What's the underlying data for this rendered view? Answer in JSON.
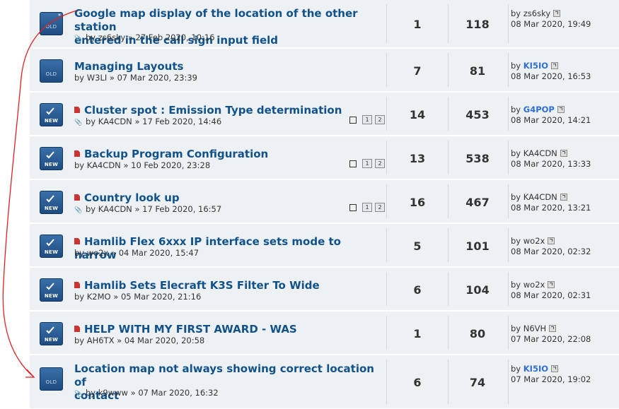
{
  "topics": [
    {
      "status": "old",
      "icon_label": "OLD",
      "star": true,
      "has_doc_icon": false,
      "title_lines": [
        "Google map display of the location of the other station",
        "entered in the call sign input field"
      ],
      "meta_prefix": "by",
      "author": "zs6sky",
      "date": "» 27 Feb 2020, 10:16",
      "attachment": true,
      "pages": [],
      "replies": "1",
      "views": "118",
      "last_by": "by",
      "last_user": "zs6sky",
      "last_user_mod": false,
      "last_date": "08 Mar 2020, 19:49"
    },
    {
      "status": "old",
      "icon_label": "OLD",
      "star": false,
      "has_doc_icon": false,
      "title_lines": [
        "Managing Layouts"
      ],
      "meta_prefix": "by",
      "author": "W3LI",
      "date": "» 07 Mar 2020, 23:39",
      "attachment": false,
      "pages": [],
      "replies": "7",
      "views": "81",
      "last_by": "by",
      "last_user": "KI5IO",
      "last_user_mod": true,
      "last_date": "08 Mar 2020, 16:53"
    },
    {
      "status": "new",
      "icon_label": "NEW",
      "star": false,
      "has_doc_icon": true,
      "title_lines": [
        "Cluster spot : Emission Type determination"
      ],
      "meta_prefix": "by",
      "author": "KA4CDN",
      "date": "» 17 Feb 2020, 14:46",
      "attachment": true,
      "pages": [
        "1",
        "2"
      ],
      "replies": "14",
      "views": "453",
      "last_by": "by",
      "last_user": "G4POP",
      "last_user_mod": true,
      "last_date": "08 Mar 2020, 14:21"
    },
    {
      "status": "new",
      "icon_label": "NEW",
      "star": false,
      "has_doc_icon": true,
      "title_lines": [
        "Backup Program Configuration"
      ],
      "meta_prefix": "by",
      "author": "KA4CDN",
      "date": "» 10 Feb 2020, 23:28",
      "attachment": false,
      "pages": [
        "1",
        "2"
      ],
      "replies": "13",
      "views": "538",
      "last_by": "by",
      "last_user": "KA4CDN",
      "last_user_mod": false,
      "last_date": "08 Mar 2020, 13:33"
    },
    {
      "status": "new",
      "icon_label": "NEW",
      "star": false,
      "has_doc_icon": true,
      "title_lines": [
        "Country look up"
      ],
      "meta_prefix": "by",
      "author": "KA4CDN",
      "date": "» 17 Feb 2020, 16:57",
      "attachment": true,
      "pages": [
        "1",
        "2"
      ],
      "replies": "16",
      "views": "467",
      "last_by": "by",
      "last_user": "KA4CDN",
      "last_user_mod": false,
      "last_date": "08 Mar 2020, 13:21"
    },
    {
      "status": "new",
      "icon_label": "NEW",
      "star": false,
      "has_doc_icon": true,
      "title_lines": [
        "Hamlib Flex 6xxx IP interface sets mode to narrow"
      ],
      "meta_prefix": "by",
      "author": "wo2x",
      "date": "» 04 Mar 2020, 15:47",
      "attachment": false,
      "pages": [],
      "replies": "5",
      "views": "101",
      "last_by": "by",
      "last_user": "wo2x",
      "last_user_mod": false,
      "last_date": "08 Mar 2020, 02:32"
    },
    {
      "status": "new",
      "icon_label": "NEW",
      "star": false,
      "has_doc_icon": true,
      "title_lines": [
        "Hamlib Sets Elecraft K3S Filter To Wide"
      ],
      "meta_prefix": "by",
      "author": "K2MO",
      "date": "» 05 Mar 2020, 21:16",
      "attachment": false,
      "pages": [],
      "replies": "6",
      "views": "104",
      "last_by": "by",
      "last_user": "wo2x",
      "last_user_mod": false,
      "last_date": "08 Mar 2020, 02:31"
    },
    {
      "status": "new",
      "icon_label": "NEW",
      "star": false,
      "has_doc_icon": true,
      "title_lines": [
        "HELP WITH MY FIRST AWARD - WAS"
      ],
      "meta_prefix": "by",
      "author": "AH6TX",
      "date": "» 04 Mar 2020, 20:58",
      "attachment": false,
      "pages": [],
      "replies": "1",
      "views": "80",
      "last_by": "by",
      "last_user": "N6VH",
      "last_user_mod": false,
      "last_date": "07 Mar 2020, 22:08"
    },
    {
      "status": "old",
      "icon_label": "OLD",
      "star": false,
      "has_doc_icon": false,
      "title_lines": [
        "Location map not always showing correct location of",
        "contact"
      ],
      "meta_prefix": "by",
      "author": "k9www",
      "date": "» 07 Mar 2020, 16:32",
      "attachment": true,
      "pages": [],
      "replies": "6",
      "views": "74",
      "last_by": "by",
      "last_user": "KI5IO",
      "last_user_mod": true,
      "last_date": "07 Mar 2020, 19:02"
    }
  ],
  "colors": {
    "row_bg": "#eef1f4",
    "title": "#105289",
    "moderator": "#2f6fd0",
    "annotation": "#e02020"
  }
}
